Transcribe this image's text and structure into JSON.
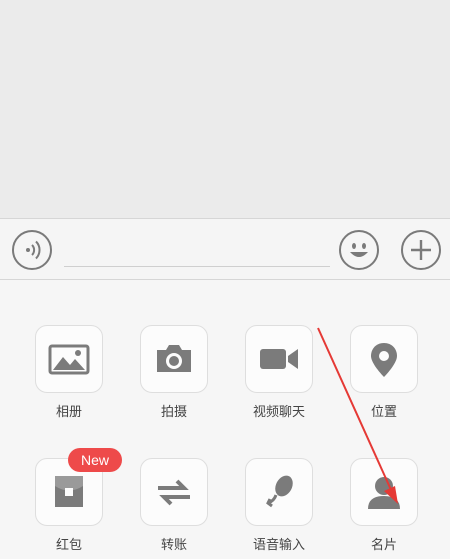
{
  "input_bar": {
    "voice_icon": "voice-icon",
    "emoji_icon": "smile-icon",
    "plus_icon": "plus-icon",
    "input_value": ""
  },
  "panel": {
    "items": [
      {
        "label": "相册",
        "icon": "image-icon"
      },
      {
        "label": "拍摄",
        "icon": "camera-icon"
      },
      {
        "label": "视频聊天",
        "icon": "video-icon"
      },
      {
        "label": "位置",
        "icon": "location-pin-icon"
      },
      {
        "label": "红包",
        "icon": "red-packet-icon",
        "badge": "New"
      },
      {
        "label": "转账",
        "icon": "transfer-icon"
      },
      {
        "label": "语音输入",
        "icon": "microphone-icon"
      },
      {
        "label": "名片",
        "icon": "contact-card-icon"
      }
    ]
  },
  "colors": {
    "icon_gray": "#7b7b7b",
    "badge_red": "#ee4a4a",
    "annotation_arrow": "#e53935"
  }
}
